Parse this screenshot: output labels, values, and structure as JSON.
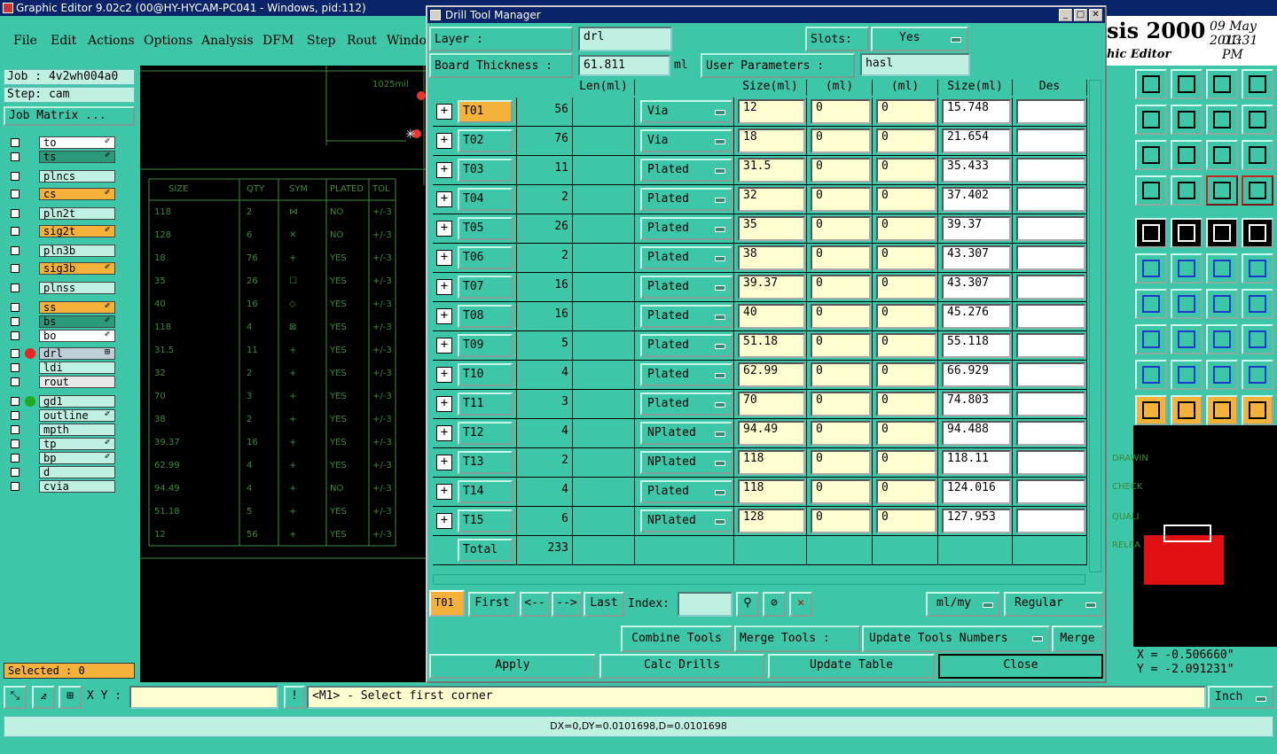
{
  "app": {
    "title": "Graphic Editor 9.02c2 (00@HY-HYCAM-PC041 - Windows, pid:112)"
  },
  "menu": [
    "File",
    "Edit",
    "Actions",
    "Options",
    "Analysis",
    "DFM",
    "Step",
    "Rout",
    "Windo"
  ],
  "brand": {
    "name": "sis 2000",
    "sub": "hic Editor",
    "date": "09 May 2013",
    "time": "01:31 PM"
  },
  "job": {
    "job": "Job : 4v2wh004a0",
    "step": "Step: cam",
    "matrix_label": "Job Matrix ..."
  },
  "layers": [
    {
      "name": "to",
      "color": "#ffffff",
      "mark": "✐"
    },
    {
      "name": "ts",
      "color": "#2a9a7a",
      "mark": "✐"
    },
    {
      "name": "plncs",
      "color": "#bff0e2",
      "mark": ""
    },
    {
      "name": "cs",
      "color": "#f5b23a",
      "mark": "✐"
    },
    {
      "name": "pln2t",
      "color": "#bff0e2",
      "mark": ""
    },
    {
      "name": "sig2t",
      "color": "#f5b23a",
      "mark": "✐"
    },
    {
      "name": "pln3b",
      "color": "#bff0e2",
      "mark": ""
    },
    {
      "name": "sig3b",
      "color": "#f5b23a",
      "mark": "✐"
    },
    {
      "name": "plnss",
      "color": "#bff0e2",
      "mark": ""
    },
    {
      "name": "ss",
      "color": "#f5b23a",
      "mark": "✐"
    },
    {
      "name": "bs",
      "color": "#2a9a7a",
      "mark": "✐"
    },
    {
      "name": "bo",
      "color": "#ffffff",
      "mark": "✐"
    },
    {
      "name": "drl",
      "color": "#bfcfd8",
      "mark": "⊞"
    },
    {
      "name": "ldi",
      "color": "#bff0e2",
      "mark": ""
    },
    {
      "name": "rout",
      "color": "#e8e8e8",
      "mark": ""
    },
    {
      "name": "gd1",
      "color": "#bff0e2",
      "mark": ""
    },
    {
      "name": "outline",
      "color": "#bff0e2",
      "mark": "✐"
    },
    {
      "name": "mpth",
      "color": "#bff0e2",
      "mark": ""
    },
    {
      "name": "tp",
      "color": "#bff0e2",
      "mark": "✐"
    },
    {
      "name": "bp",
      "color": "#bff0e2",
      "mark": "✐"
    },
    {
      "name": "d",
      "color": "#bff0e2",
      "mark": ""
    },
    {
      "name": "cvia",
      "color": "#bff0e2",
      "mark": ""
    }
  ],
  "selected_text": "Selected : 0",
  "canvas_table": {
    "dim_label": "1025mil",
    "headers": [
      "SIZE",
      "QTY",
      "SYM",
      "PLATED",
      "TOL"
    ],
    "rows": [
      [
        "118",
        "2",
        "⋈",
        "NO",
        "+/-3"
      ],
      [
        "128",
        "6",
        "✕",
        "NO",
        "+/-3"
      ],
      [
        "18",
        "76",
        "+",
        "YES",
        "+/-3"
      ],
      [
        "35",
        "26",
        "☐",
        "YES",
        "+/-3"
      ],
      [
        "40",
        "16",
        "◇",
        "YES",
        "+/-3"
      ],
      [
        "118",
        "4",
        "⊠",
        "YES",
        "+/-3"
      ],
      [
        "31.5",
        "11",
        "+",
        "YES",
        "+/-3"
      ],
      [
        "32",
        "2",
        "+",
        "YES",
        "+/-3"
      ],
      [
        "70",
        "3",
        "+",
        "YES",
        "+/-3"
      ],
      [
        "38",
        "2",
        "+",
        "YES",
        "+/-3"
      ],
      [
        "39.37",
        "16",
        "+",
        "YES",
        "+/-3"
      ],
      [
        "62.99",
        "4",
        "+",
        "YES",
        "+/-3"
      ],
      [
        "94.49",
        "4",
        "+",
        "NO",
        "+/-3"
      ],
      [
        "51.18",
        "5",
        "+",
        "YES",
        "+/-3"
      ],
      [
        "12",
        "56",
        "+",
        "YES",
        "+/-3"
      ]
    ]
  },
  "dialog": {
    "title": "Drill Tool Manager",
    "layer_label": "Layer        :",
    "layer_value": "drl",
    "slots_label": "Slots:",
    "slots_value": "Yes",
    "thickness_label": "Board Thickness  :",
    "thickness_value": "61.811",
    "thickness_unit": "ml",
    "user_params_label": "User Parameters :",
    "user_params_value": "hasl",
    "columns": [
      "",
      "Len(ml)",
      "",
      "Size(ml)",
      "(ml)",
      "(ml)",
      "Size(ml)",
      "Des"
    ],
    "rows": [
      {
        "tool": "T01",
        "count": "56",
        "type": "Via",
        "size": "12",
        "tp": "0",
        "tm": "0",
        "fsize": "15.748"
      },
      {
        "tool": "T02",
        "count": "76",
        "type": "Via",
        "size": "18",
        "tp": "0",
        "tm": "0",
        "fsize": "21.654"
      },
      {
        "tool": "T03",
        "count": "11",
        "type": "Plated",
        "size": "31.5",
        "tp": "0",
        "tm": "0",
        "fsize": "35.433"
      },
      {
        "tool": "T04",
        "count": "2",
        "type": "Plated",
        "size": "32",
        "tp": "0",
        "tm": "0",
        "fsize": "37.402"
      },
      {
        "tool": "T05",
        "count": "26",
        "type": "Plated",
        "size": "35",
        "tp": "0",
        "tm": "0",
        "fsize": "39.37"
      },
      {
        "tool": "T06",
        "count": "2",
        "type": "Plated",
        "size": "38",
        "tp": "0",
        "tm": "0",
        "fsize": "43.307"
      },
      {
        "tool": "T07",
        "count": "16",
        "type": "Plated",
        "size": "39.37",
        "tp": "0",
        "tm": "0",
        "fsize": "43.307"
      },
      {
        "tool": "T08",
        "count": "16",
        "type": "Plated",
        "size": "40",
        "tp": "0",
        "tm": "0",
        "fsize": "45.276"
      },
      {
        "tool": "T09",
        "count": "5",
        "type": "Plated",
        "size": "51.18",
        "tp": "0",
        "tm": "0",
        "fsize": "55.118"
      },
      {
        "tool": "T10",
        "count": "4",
        "type": "Plated",
        "size": "62.99",
        "tp": "0",
        "tm": "0",
        "fsize": "66.929"
      },
      {
        "tool": "T11",
        "count": "3",
        "type": "Plated",
        "size": "70",
        "tp": "0",
        "tm": "0",
        "fsize": "74.803"
      },
      {
        "tool": "T12",
        "count": "4",
        "type": "NPlated",
        "size": "94.49",
        "tp": "0",
        "tm": "0",
        "fsize": "94.488"
      },
      {
        "tool": "T13",
        "count": "2",
        "type": "NPlated",
        "size": "118",
        "tp": "0",
        "tm": "0",
        "fsize": "118.11"
      },
      {
        "tool": "T14",
        "count": "4",
        "type": "Plated",
        "size": "118",
        "tp": "0",
        "tm": "0",
        "fsize": "124.016"
      },
      {
        "tool": "T15",
        "count": "6",
        "type": "NPlated",
        "size": "128",
        "tp": "0",
        "tm": "0",
        "fsize": "127.953"
      }
    ],
    "total_label": "Total",
    "total_value": "233",
    "nav": {
      "current": "T01",
      "first": "First",
      "prev": "<--",
      "next": "-->",
      "last": "Last",
      "index_label": "Index:",
      "units": "ml/my",
      "mode": "Regular"
    },
    "actions": {
      "combine": "Combine Tools",
      "merge_label": "Merge Tools :",
      "update_numbers": "Update Tools Numbers",
      "merge": "Merge"
    },
    "footer": {
      "apply": "Apply",
      "calc": "Calc Drills",
      "update": "Update Table",
      "close": "Close"
    }
  },
  "command": {
    "xy_label": "X Y :",
    "prompt": "<M1> - Select first corner",
    "units": "Inch"
  },
  "status": "DX=0,DY=0.0101698,D=0.0101698",
  "coords": {
    "x": "X = -0.506660\"",
    "y": "Y = -2.091231\""
  },
  "minimap_labels": [
    "DRAWIN",
    "CHECK",
    "QUALI",
    "RELEA"
  ]
}
